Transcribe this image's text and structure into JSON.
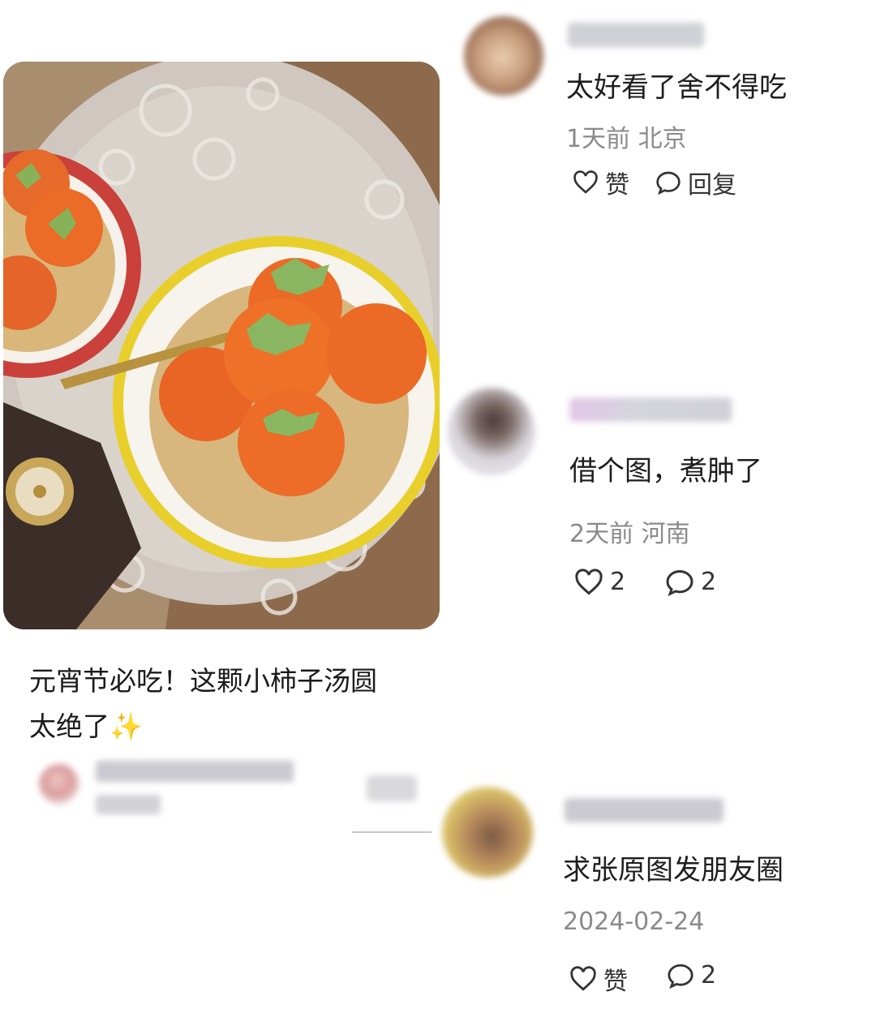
{
  "post": {
    "title_line1": "元宵节必吃！这颗小柿子汤圆",
    "title_line2": "太绝了",
    "title_emoji": "✨"
  },
  "comments": [
    {
      "text": "太好看了舍不得吃",
      "time": "1天前",
      "location": "北京",
      "like_label": "赞",
      "reply_label": "回复"
    },
    {
      "text": "借个图，煮肿了",
      "time": "2天前",
      "location": "河南",
      "like_count": "2",
      "reply_count": "2"
    },
    {
      "text": "求张原图发朋友圈",
      "date": "2024-02-24",
      "like_label": "赞",
      "reply_count": "2"
    }
  ],
  "icons": {
    "like": "heart-outline-icon",
    "reply": "speech-bubble-icon"
  }
}
